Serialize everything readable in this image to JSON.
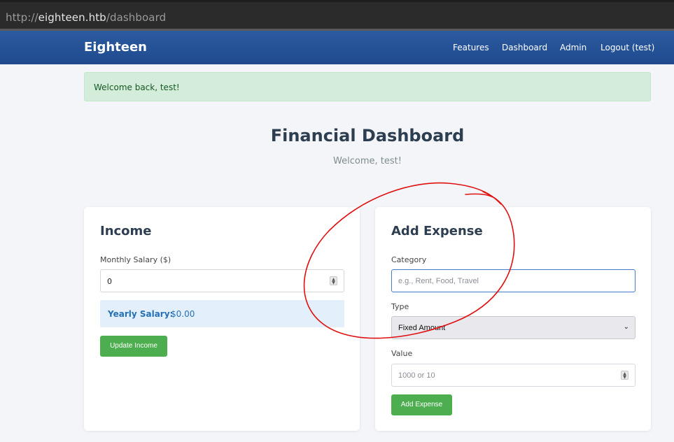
{
  "browser": {
    "url_prefix": "http://",
    "url_host": "eighteen.htb",
    "url_path": "/dashboard"
  },
  "navbar": {
    "brand": "Eighteen",
    "links": [
      "Features",
      "Dashboard",
      "Admin",
      "Logout (test)"
    ]
  },
  "alert": {
    "text": "Welcome back, test!"
  },
  "page": {
    "title": "Financial Dashboard",
    "subtitle": "Welcome, test!"
  },
  "income": {
    "title": "Income",
    "salary_label": "Monthly Salary ($)",
    "salary_value": "0",
    "yearly_label": "Yearly Salary:",
    "yearly_value": "$0.00",
    "button": "Update Income"
  },
  "expense": {
    "title": "Add Expense",
    "category_label": "Category",
    "category_placeholder": "e.g., Rent, Food, Travel",
    "type_label": "Type",
    "type_value": "Fixed Amount",
    "value_label": "Value",
    "value_placeholder": "1000 or 10",
    "button": "Add Expense"
  },
  "colors": {
    "navbar": "#2c5aa0",
    "button": "#4cae4f",
    "annotation": "#e01010"
  }
}
